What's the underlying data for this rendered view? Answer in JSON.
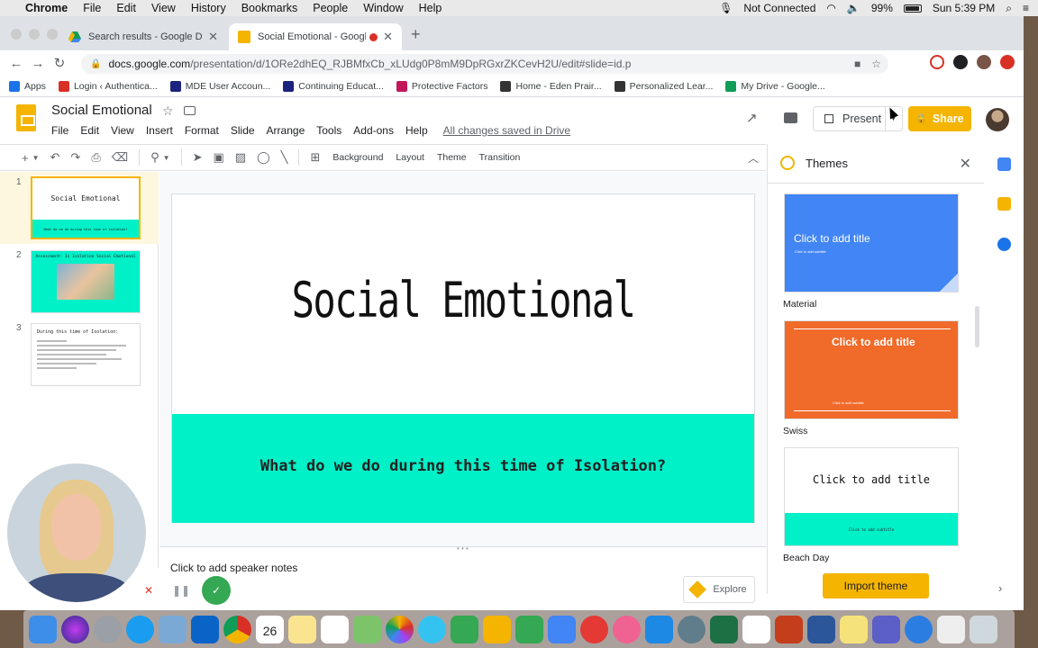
{
  "menubar": {
    "app": "Chrome",
    "items": [
      "File",
      "Edit",
      "View",
      "History",
      "Bookmarks",
      "People",
      "Window",
      "Help"
    ],
    "status": {
      "network": "Not Connected",
      "battery": "99%",
      "clock": "Sun 5:39 PM"
    }
  },
  "browser": {
    "tabs": [
      {
        "title": "Search results - Google Drive"
      },
      {
        "title": "Social Emotional - Google"
      }
    ],
    "url_host": "docs.google.com",
    "url_path": "/presentation/d/1ORe2dhEQ_RJBMfxCb_xLUdg0P8mM9DpRGxrZKCevH2U/edit#slide=id.p",
    "bookmarks": [
      {
        "label": "Apps",
        "color": "#1a73e8"
      },
      {
        "label": "Login ‹ Authentica...",
        "color": "#d93025"
      },
      {
        "label": "MDE User Accoun...",
        "color": "#1a237e"
      },
      {
        "label": "Continuing Educat...",
        "color": "#1a237e"
      },
      {
        "label": "Protective Factors",
        "color": "#c2185b"
      },
      {
        "label": "Home - Eden Prair...",
        "color": "#333333"
      },
      {
        "label": "Personalized Lear...",
        "color": "#333333"
      },
      {
        "label": "My Drive - Google...",
        "color": "#0f9d58"
      }
    ]
  },
  "docs": {
    "title": "Social Emotional",
    "menus": [
      "File",
      "Edit",
      "View",
      "Insert",
      "Format",
      "Slide",
      "Arrange",
      "Tools",
      "Add-ons",
      "Help"
    ],
    "saved_status": "All changes saved in Drive",
    "present_label": "Present",
    "share_label": "Share"
  },
  "toolbar": {
    "background": "Background",
    "layout": "Layout",
    "theme": "Theme",
    "transition": "Transition"
  },
  "filmstrip": [
    {
      "num": "1",
      "title": "Social Emotional",
      "subtitle": "What do we do during this time of Isolation?"
    },
    {
      "num": "2",
      "title": "Assessment: Is Isolation Social Emotional"
    },
    {
      "num": "3",
      "title": "During this time of Isolation:"
    }
  ],
  "slide": {
    "title": "Social Emotional",
    "subtitle": "What do we do during this time of Isolation?",
    "accent": "#00f0c8"
  },
  "notes": {
    "placeholder": "Click to add speaker notes"
  },
  "explore": {
    "label": "Explore"
  },
  "themes": {
    "title": "Themes",
    "items": [
      {
        "name": "Material",
        "title": "Click to add title",
        "subtitle": "Click to add subtitle"
      },
      {
        "name": "Swiss",
        "title": "Click to add title",
        "subtitle": "Click to add subtitle"
      },
      {
        "name": "Beach Day",
        "title": "Click to add title",
        "subtitle": "Click to add subtitle"
      }
    ],
    "import_label": "Import theme"
  },
  "dock": {
    "calendar_day": "26",
    "apps": [
      "finder",
      "siri",
      "launchpad",
      "safari",
      "mail",
      "outlook",
      "chrome",
      "calendar",
      "notes",
      "reminders",
      "maps",
      "photos",
      "messages",
      "facetime",
      "keynote",
      "numbers",
      "pages",
      "news",
      "music",
      "app-store",
      "system-preferences",
      "excel",
      "textedit",
      "powerpoint",
      "word",
      "stickies",
      "teams",
      "internet",
      "preview",
      "trash"
    ]
  }
}
